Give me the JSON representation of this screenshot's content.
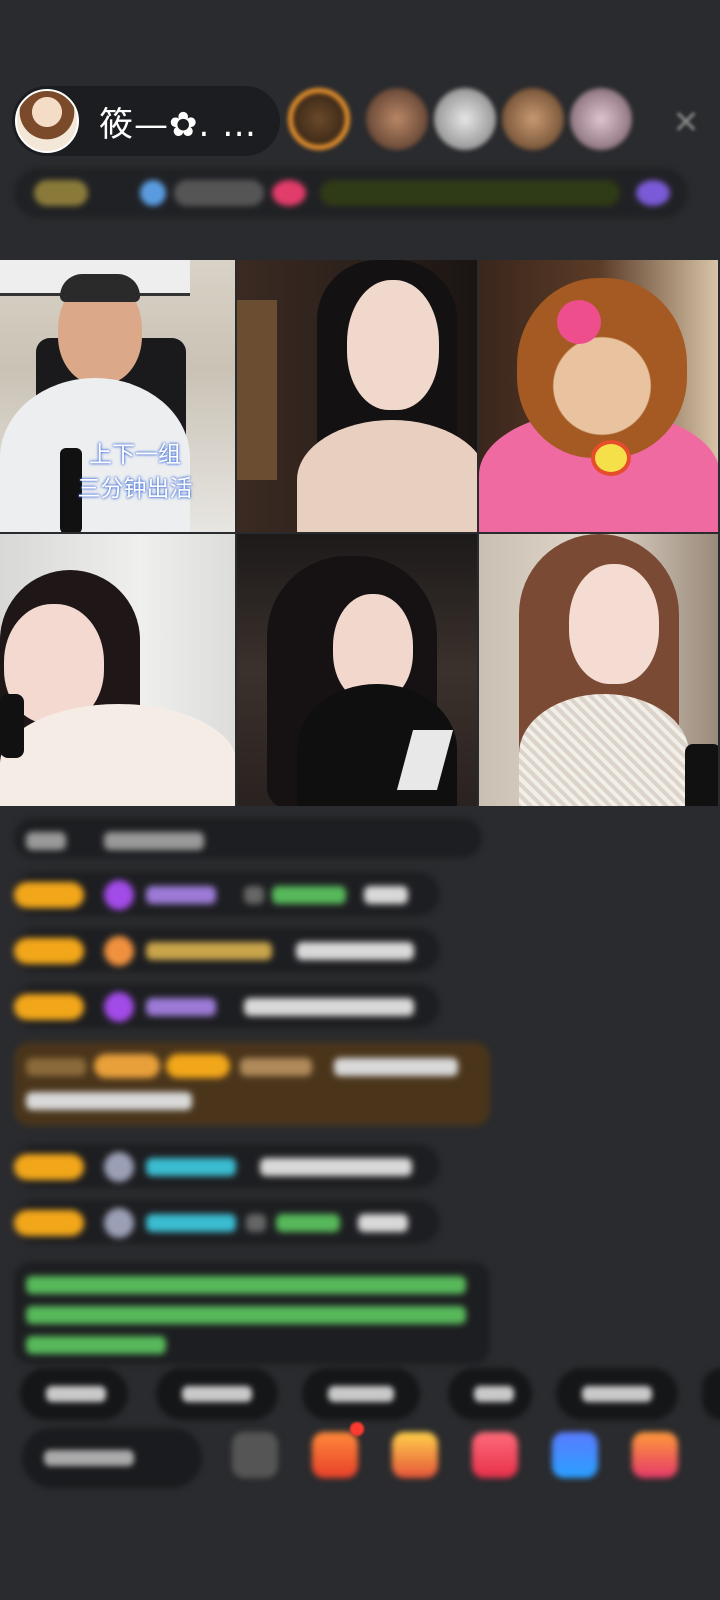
{
  "header": {
    "host_name": "筱—✿. …",
    "close_label": "✕"
  },
  "grid": {
    "caption": "上下一组\n三分钟出活"
  },
  "colors": {
    "background": "#2a2b2e",
    "badge_gold": "#f2a61a",
    "gem_purple": "#a24be8",
    "name_green": "#57b85a",
    "name_cyan": "#3bbcd1",
    "system_msg_bg": "#4a351b"
  },
  "icons": {
    "close": "close-icon",
    "gift": "gift-icon",
    "more": "more-icon"
  }
}
